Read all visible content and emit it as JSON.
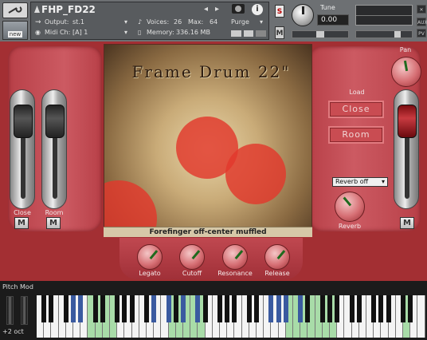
{
  "header": {
    "instrument_title": "FHP_FD22",
    "new_label": "new",
    "output_label": "Output:",
    "output_value": "st.1",
    "midi_label": "Midi Ch:",
    "midi_value": "[A]  1",
    "voices_label": "Voices:",
    "voices_value": "26",
    "max_label": "Max:",
    "max_value": "64",
    "memory_label": "Memory:",
    "memory_value": "336.16 MB",
    "purge_label": "Purge",
    "solo_label": "S",
    "mute_label": "M",
    "tune_label": "Tune",
    "tune_value": "0.00",
    "aux_label": "AUX",
    "pv_label": "PV"
  },
  "center": {
    "title": "Frame Drum 22\"",
    "caption": "Forefinger off-center muffled"
  },
  "left_panel": {
    "fader1_label": "Close",
    "fader2_label": "Room",
    "mute1": "M",
    "mute2": "M"
  },
  "right_panel": {
    "pan_label": "Pan",
    "load_label": "Load",
    "close_button": "Close",
    "room_button": "Room",
    "reverb_select": "Reverb off",
    "reverb_knob_label": "Reverb",
    "mute": "M"
  },
  "bottom_knobs": {
    "legato": "Legato",
    "cutoff": "Cutoff",
    "resonance": "Resonance",
    "release": "Release"
  },
  "keyboard": {
    "pitch_mod_label": "Pitch Mod",
    "octave_label": "+2 oct"
  },
  "colors": {
    "accent_red": "#a32f33",
    "circle_red": "#e2382c",
    "key_green": "#a8dca8",
    "key_blue": "#3a5aa0"
  }
}
